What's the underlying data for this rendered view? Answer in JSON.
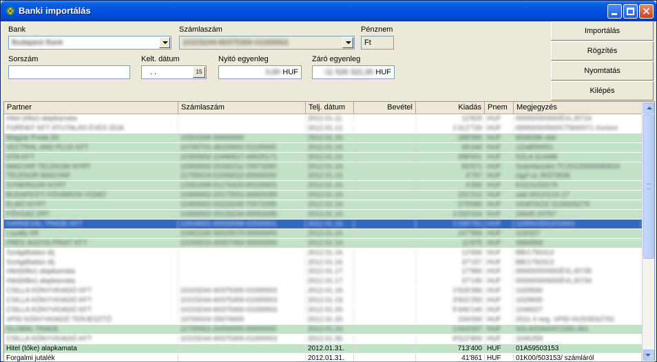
{
  "window": {
    "title": "Banki importálás"
  },
  "form": {
    "bank_label": "Bank",
    "bank_value": "Budapest Bank",
    "account_label": "Számlaszám",
    "account_value": "10103244-60375300-01000002",
    "currency_label": "Pénznem",
    "currency_value": "Ft",
    "serial_label": "Sorszám",
    "serial_value": "",
    "date_label": "Kelt. dátum",
    "date_value": " . .",
    "calendar_label": "15",
    "opening_label": "Nyitó egyenleg",
    "opening_value": "0,00",
    "opening_unit": "HUF",
    "closing_label": "Záró egyenleg",
    "closing_value": "-11 526 322,30",
    "closing_unit": "HUF"
  },
  "buttons": {
    "import": "Importálás",
    "record": "Rögzítés",
    "print": "Nyomtatás",
    "exit": "Kilépés"
  },
  "grid": {
    "columns": [
      "Partner",
      "Számlaszám",
      "Telj. dátum",
      "Bevétel",
      "Kiadás",
      "Pnem",
      "Megjegyzés"
    ],
    "rows": [
      {
        "style": "white",
        "partner": "Hitel (tőke) alapkamata",
        "account": "",
        "date": "2012.01.11.",
        "income": "",
        "expense": "12'829",
        "cur": "HUF",
        "note": "00000/00/000/ÉVLJ0724"
      },
      {
        "style": "white",
        "partner": "FORFAIT KFT ÁTUTALÁS ÉVES DÍJA",
        "account": "",
        "date": "2012.01.12.",
        "income": "",
        "expense": "1'312'726",
        "cur": "HUF",
        "note": "00000/00/000/CTM40071 Invoice"
      },
      {
        "style": "green",
        "partner": "Magyar Posta Zrt",
        "account": "10201006-50000000",
        "date": "2012.01.16.",
        "income": "",
        "expense": "288'000",
        "cur": "HUF",
        "note": "8206286 utal"
      },
      {
        "style": "green",
        "partner": "VECTRAL AND PLUS KFT",
        "account": "10700701-46100002-51100000",
        "date": "2012.01.16.",
        "income": "",
        "expense": "58'440",
        "cur": "HUF",
        "note": "12/all/00051"
      },
      {
        "style": "green",
        "partner": "OTA KFT",
        "account": "10300002-10490017-49020171",
        "date": "2012.01.16.",
        "income": "",
        "expense": "399'601",
        "cur": "HUF",
        "note": "SZLA 314486"
      },
      {
        "style": "green",
        "partner": "MAGYAR TELEKOM NYRT",
        "account": "10300002-20182211-70073280",
        "date": "2012.01.16.",
        "income": "",
        "expense": "83'971",
        "cur": "HUF",
        "note": "Számlaszám:TC20120000080024"
      },
      {
        "style": "green",
        "partner": "TELENOR MAGYAR",
        "account": "11700019-01046022-00000000",
        "date": "2012.01.16.",
        "income": "",
        "expense": "4'797",
        "cur": "HUF",
        "note": "ügyf sz 26373636"
      },
      {
        "style": "green",
        "partner": "SYNERGON NYRT",
        "account": "12001008-01176420-00100003",
        "date": "2012.01.16.",
        "income": "",
        "expense": "4'305",
        "cur": "HUF",
        "note": "KSZ11/03176"
      },
      {
        "style": "green",
        "partner": "BUDAPESTI FŐVÁROSI VÍZMŰ",
        "account": "10300002-20172551-00003285",
        "date": "2012.01.16.",
        "income": "",
        "expense": "231'212",
        "cur": "HUF",
        "note": "utal 2012/1/16.17"
      },
      {
        "style": "green",
        "partner": "ELMŰ NYRT",
        "account": "10300002-20110245-70073285",
        "date": "2012.01.16.",
        "income": "",
        "expense": "279'685",
        "cur": "HUF",
        "note": "HIVATKOZ 3120025279"
      },
      {
        "style": "green",
        "partner": "FŐVGÁZ ZRT",
        "account": "10300002-20133234-00003285",
        "date": "2012.01.16.",
        "income": "",
        "expense": "1'232'024",
        "cur": "HUF",
        "note": "24645 24767"
      },
      {
        "style": "sel",
        "partner": "KARNEVÁL TRADE KFT",
        "account": "10918001-00000068-02520001",
        "date": "2012.01.16.",
        "income": "",
        "expense": "1'156'791",
        "cur": "HUF",
        "note": "12/INV/2012/10001"
      },
      {
        "style": "green",
        "partner": "Loyalty Kft",
        "account": "10402166-50526570-00000000",
        "date": "2012.01.16.",
        "income": "",
        "expense": "247'956",
        "cur": "HUF",
        "note": "119/327"
      },
      {
        "style": "green",
        "partner": "PRÉS ÁGOTA PRINT KFT",
        "account": "10200010-40007454-00000000",
        "date": "2012.01.16.",
        "income": "",
        "expense": "11'875",
        "cur": "HUF",
        "note": "4966858"
      },
      {
        "style": "white",
        "partner": "Szolgáltatási díj",
        "account": "",
        "date": "2012.01.16.",
        "income": "",
        "expense": "12'656",
        "cur": "HUF",
        "note": "BB/1750313"
      },
      {
        "style": "white",
        "partner": "Szolgáltatási díj",
        "account": "",
        "date": "2012.01.16.",
        "income": "",
        "expense": "37'157",
        "cur": "HUF",
        "note": "BB/1750313"
      },
      {
        "style": "white",
        "partner": "Hitel(tőke) alapkamata",
        "account": "",
        "date": "2012.01.17.",
        "income": "",
        "expense": "17'950",
        "cur": "HUF",
        "note": "00000/00/000/ÉVLJ0735"
      },
      {
        "style": "white",
        "partner": "Hitel(tőke) alapkamata",
        "account": "",
        "date": "2012.01.17.",
        "income": "",
        "expense": "37'140",
        "cur": "HUF",
        "note": "00000/00/000/ÉVLJ0734"
      },
      {
        "style": "white",
        "partner": "CSILLA KÖNYVKIADÓ KFT",
        "account": "10103244-60375300-01000003",
        "date": "2012.01.18.",
        "income": "",
        "expense": "1'628'390",
        "cur": "HUF",
        "note": "1029930"
      },
      {
        "style": "white",
        "partner": "CSILLA KÖNYVKIADÓ KFT",
        "account": "10103244-60375300-01000003",
        "date": "2012.01.19.",
        "income": "",
        "expense": "3'602'250",
        "cur": "HUF",
        "note": "1029935"
      },
      {
        "style": "white",
        "partner": "CSILLA KÖNYVKIADÓ KFT",
        "account": "10103244-60375300-01000003",
        "date": "2012.01.20.",
        "income": "",
        "expense": "5'446'140",
        "cur": "HUF",
        "note": "1046027"
      },
      {
        "style": "white",
        "partner": "VPID KÖNYVKIADÓ TERJESZTŐ",
        "account": "10700024-25076000",
        "date": "2012.01.20.",
        "income": "",
        "expense": "234'000",
        "cur": "HUF",
        "note": "2011 4 neg. VPID HUSSE62762"
      },
      {
        "style": "green",
        "partner": "GLOBÁL TRADE",
        "account": "11700002-20000000-00000000",
        "date": "2012.01.24.",
        "income": "",
        "expense": "1'004'937",
        "cur": "HUF",
        "note": "SZLA/2344/472282,361"
      },
      {
        "style": "white",
        "partner": "CSILLA KÖNYVKIADÓ KFT",
        "account": "10103244-60375300-01000003",
        "date": "2012.01.30.",
        "income": "",
        "expense": "8'522'800",
        "cur": "HUF",
        "note": "1046259"
      },
      {
        "style": "green",
        "partner": "Hitel (tőke) alapkamata",
        "account": "",
        "date": "2012.01.31.",
        "income": "",
        "expense": "713'400",
        "cur": "HUF",
        "note": "01A59503153"
      },
      {
        "style": "white",
        "partner": "Forgalmi jutalék",
        "account": "",
        "date": "2012.01.31.",
        "income": "",
        "expense": "41'861",
        "cur": "HUF",
        "note": "01K00/503153/ számláról"
      }
    ]
  }
}
